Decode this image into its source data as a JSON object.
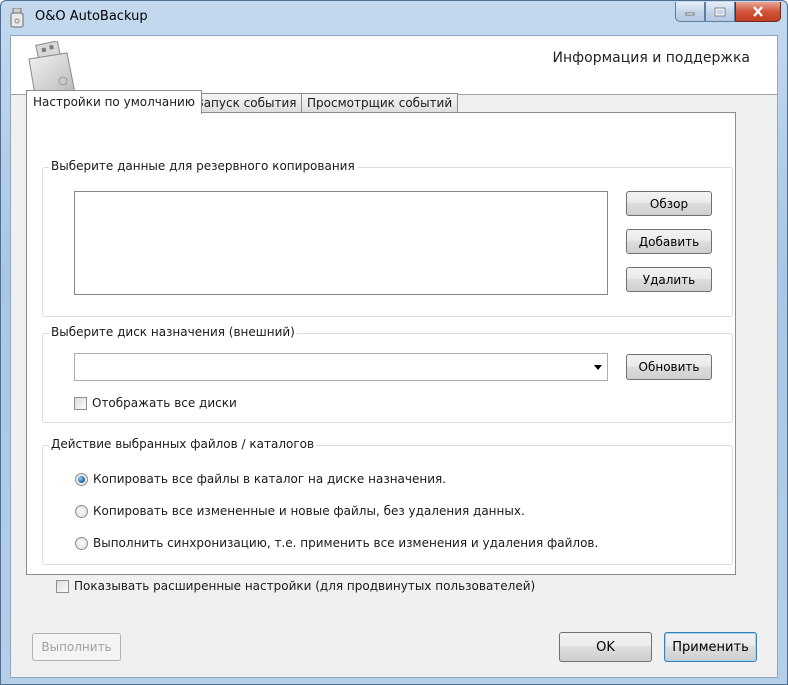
{
  "window": {
    "title": "O&O AutoBackup"
  },
  "header": {
    "title": "Информация и поддержка"
  },
  "tabs": [
    {
      "label": "Настройки по умолчанию",
      "active": true
    },
    {
      "label": "Запуск события",
      "active": false
    },
    {
      "label": "Просмотрщик событий",
      "active": false
    }
  ],
  "source_group": {
    "label": "Выберите данные для резервного копирования",
    "buttons": {
      "browse": "Обзор",
      "add": "Добавить",
      "remove": "Удалить"
    },
    "items": []
  },
  "destination_group": {
    "label": "Выберите диск назначения (внешний)",
    "selected": "",
    "refresh_button": "Обновить",
    "show_all_checkbox": {
      "label": "Отображать все диски",
      "checked": false
    }
  },
  "action_group": {
    "label": "Действие выбранных файлов / каталогов",
    "options": [
      {
        "label": "Копировать все файлы в каталог на диске назначения.",
        "selected": true
      },
      {
        "label": "Копировать все измененные и новые файлы, без удаления данных.",
        "selected": false
      },
      {
        "label": "Выполнить синхронизацию, т.е. применить все изменения и удаления файлов.",
        "selected": false
      }
    ]
  },
  "advanced_checkbox": {
    "label": "Показывать расширенные настройки (для продвинутых пользователей)",
    "checked": false
  },
  "footer": {
    "run_button": "Выполнить",
    "ok_button": "OK",
    "apply_button": "Применить"
  },
  "colors": {
    "frame": "#b6cfe9",
    "client": "#f0f0f0",
    "radio_selected": "#1d5f9d"
  }
}
